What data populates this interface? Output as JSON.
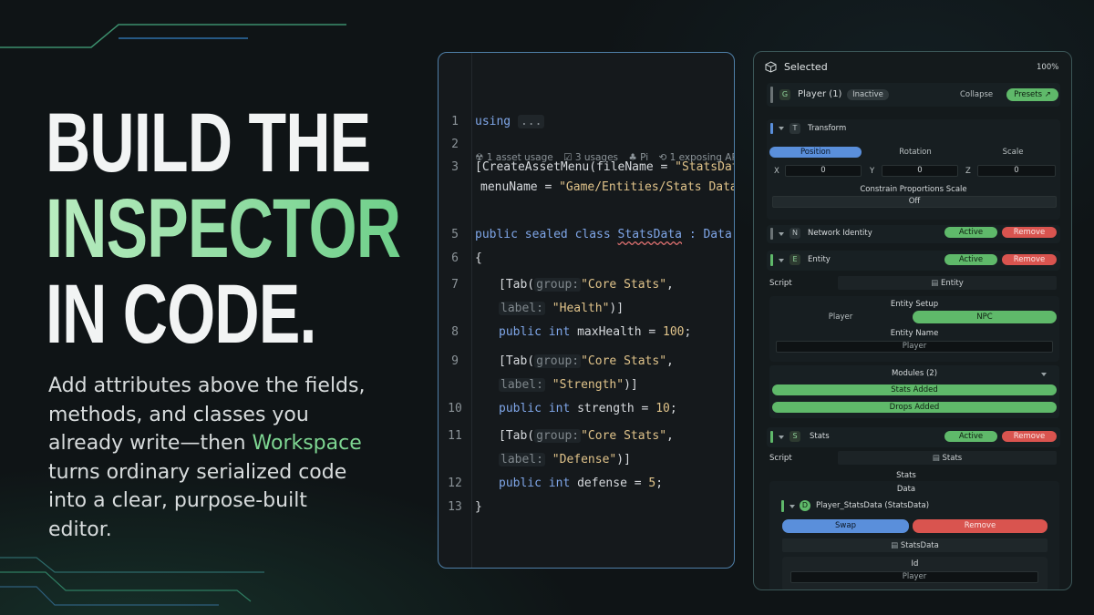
{
  "hero": {
    "line1": "BUILD THE",
    "line2": "INSPECTOR",
    "line3": "IN CODE.",
    "desc_before": "Add attributes above the fields, methods, and classes you already write—then ",
    "desc_accent": "Workspace",
    "desc_after": " turns ordinary serialized code into a clear, purpose-built editor."
  },
  "code": {
    "lines": {
      "l1_num": "1",
      "l1_kw": "using",
      "l1_fold": "...",
      "l2_num": "2",
      "l3_num": "3",
      "l3_a": "[CreateAssetMenu(fileName = ",
      "l3_str": "\"StatsData\"",
      "l3_b": ",",
      "l3b_a": "menuName = ",
      "l3b_str": "\"Game/Entities/Stats Data\"",
      "l3b_b": ")]",
      "l5_num": "5",
      "l5_kw": "public sealed class",
      "l5_name": "StatsData",
      "l5_rest": " : Data",
      "l6_num": "6",
      "l6_text": "{",
      "l7_num": "7",
      "l7_a": "[Tab(",
      "l7_hint": "group:",
      "l7_str": "\"Core Stats\"",
      "l7_b": ",",
      "l7b_hint": "label:",
      "l7b_str": "\"Health\"",
      "l7b_b": ")]",
      "l8_num": "8",
      "l8_kw": "public int",
      "l8_a": " maxHealth = ",
      "l8_num_val": "100",
      "l8_b": ";",
      "l9_num": "9",
      "l9_a": "[Tab(",
      "l9_hint": "group:",
      "l9_str": "\"Core Stats\"",
      "l9_b": ",",
      "l9b_hint": "label:",
      "l9b_str": "\"Strength\"",
      "l9b_b": ")]",
      "l10_num": "10",
      "l10_kw": "public int",
      "l10_a": " strength = ",
      "l10_num_val": "10",
      "l10_b": ";",
      "l11_num": "11",
      "l11_a": "[Tab(",
      "l11_hint": "group:",
      "l11_str": "\"Core Stats\"",
      "l11_b": ",",
      "l11b_hint": "label:",
      "l11b_str": "\"Defense\"",
      "l11b_b": ")]",
      "l12_num": "12",
      "l12_kw": "public int",
      "l12_a": " defense = ",
      "l12_num_val": "5",
      "l12_b": ";",
      "l13_num": "13",
      "l13_text": "}"
    },
    "codelens": {
      "asset_usage": "☢ 1 asset usage",
      "usages": "☑ 3 usages",
      "pi": "♣ Pi",
      "api": "⟲ 1 exposing API"
    }
  },
  "inspector": {
    "title": "Selected",
    "zoom": "100%",
    "object": {
      "icon": "G",
      "name": "Player (1)",
      "status": "Inactive",
      "collapse": "Collapse",
      "presets": "Presets ↗"
    },
    "transform": {
      "icon": "T",
      "label": "Transform",
      "tabs": [
        "Position",
        "Rotation",
        "Scale"
      ],
      "x_label": "X",
      "x_val": "0",
      "y_label": "Y",
      "y_val": "0",
      "z_label": "Z",
      "z_val": "0",
      "constrain_label": "Constrain Proportions Scale",
      "constrain_val": "Off"
    },
    "network": {
      "icon": "N",
      "label": "Network Identity",
      "active": "Active",
      "remove": "Remove"
    },
    "entity": {
      "icon": "E",
      "label": "Entity",
      "active": "Active",
      "remove": "Remove",
      "script_label": "Script",
      "script_val": "Entity",
      "setup_label": "Entity Setup",
      "opt_player": "Player",
      "opt_npc": "NPC",
      "name_label": "Entity Name",
      "name_val": "Player",
      "modules_label": "Modules (2)",
      "mod1": "Stats Added",
      "mod2": "Drops Added"
    },
    "stats": {
      "icon": "S",
      "label": "Stats",
      "active": "Active",
      "remove": "Remove",
      "script_label": "Script",
      "script_val": "Stats",
      "stats_label": "Stats",
      "data_label": "Data",
      "data_icon": "D",
      "data_name": "Player_StatsData (StatsData)",
      "swap": "Swap",
      "remove2": "Remove",
      "file_val": "StatsData",
      "id_label": "Id",
      "id_val": "Player"
    }
  },
  "colors": {
    "accent_green": "#7ed692",
    "code_border": "#4f7fa8",
    "active_green": "#5fb96a",
    "remove_red": "#d9544f",
    "swap_blue": "#5a8fdb"
  }
}
